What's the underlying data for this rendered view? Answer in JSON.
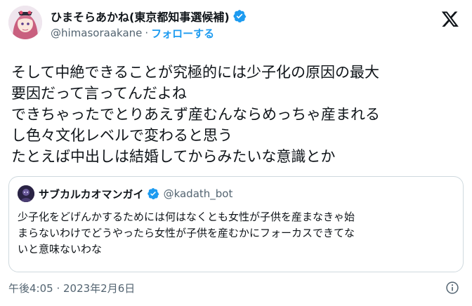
{
  "author": {
    "display_name": "ひまそらあかね(東京都知事選候補)",
    "handle": "@himasoraakane",
    "separator": "·",
    "follow_label": "フォローする"
  },
  "tweet": {
    "text": "そして中絶できることが究極的には少子化の原因の最大\n要因だって言ってんだよね\nできちゃったでとりあえず産むんならめっちゃ産まれる\nし色々文化レベルで変わると思う\nたとえば中出しは結婚してからみたいな意識とか"
  },
  "quote": {
    "display_name": "サブカルカオマンガイ",
    "handle": "@kadath_bot",
    "text": "少子化をどげんかするためには何はなくとも女性が子供を産まなきゃ始\nまらないわけでどうやったら女性が子供を産むかにフォーカスできてな\nいと意味ないわな"
  },
  "footer": {
    "timestamp": "午後4:05 · 2023年2月6日"
  },
  "icons": {
    "verified": "verified-badge-icon",
    "x_logo": "x-logo-icon",
    "info": "info-icon"
  },
  "colors": {
    "accent": "#1d9bf0",
    "text": "#0f1419",
    "muted": "#536471",
    "border": "#cfd9de"
  }
}
